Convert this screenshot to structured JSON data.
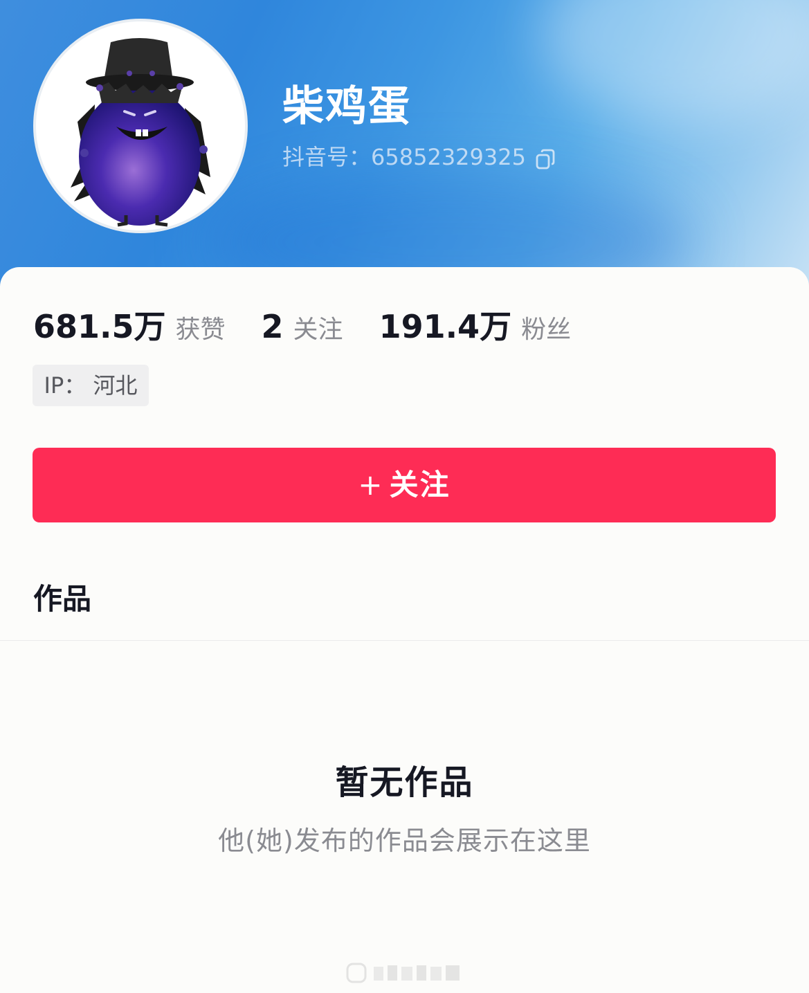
{
  "profile": {
    "nickname": "柴鸡蛋",
    "douyin_id_label": "抖音号：",
    "douyin_id": "65852329325"
  },
  "stats": [
    {
      "value": "681.5万",
      "label": "获赞"
    },
    {
      "value": "2",
      "label": "关注"
    },
    {
      "value": "191.4万",
      "label": "粉丝"
    }
  ],
  "ip_tag": "IP：  河北",
  "follow_button": {
    "icon": "plus-icon",
    "plus": "+",
    "label": "关注"
  },
  "tabs": {
    "works": "作品"
  },
  "empty_state": {
    "title": "暂无作品",
    "description": "他(她)发布的作品会展示在这里"
  },
  "colors": {
    "accent": "#fe2c55",
    "header_blue": "#2f86dc",
    "text_primary": "#161823",
    "text_secondary": "#8a8b91"
  },
  "icons": [
    "copy-icon",
    "plus-icon",
    "avatar-egg-character"
  ]
}
